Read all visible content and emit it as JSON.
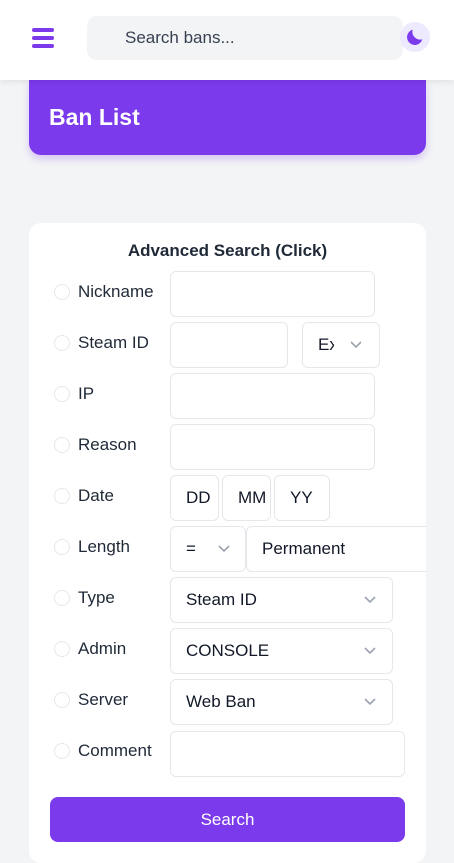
{
  "topbar": {
    "search_placeholder": "Search bans...",
    "menu_icon": "hamburger-icon",
    "theme_icon": "moon-icon"
  },
  "header": {
    "title": "Ban List"
  },
  "colors": {
    "accent": "#7c3aed",
    "background": "#f3f4f6"
  },
  "advanced_search": {
    "title": "Advanced Search (Click)",
    "fields": {
      "nickname": {
        "label": "Nickname",
        "value": ""
      },
      "steam_id": {
        "label": "Steam ID",
        "value": "",
        "match_select": "Ex"
      },
      "ip": {
        "label": "IP",
        "value": ""
      },
      "reason": {
        "label": "Reason",
        "value": ""
      },
      "date": {
        "label": "Date",
        "day": "DD",
        "month": "MM",
        "year": "YY"
      },
      "length": {
        "label": "Length",
        "operator": "=",
        "value": "Permanent"
      },
      "type": {
        "label": "Type",
        "value": "Steam ID"
      },
      "admin": {
        "label": "Admin",
        "value": "CONSOLE"
      },
      "server": {
        "label": "Server",
        "value": "Web Ban"
      },
      "comment": {
        "label": "Comment",
        "value": ""
      }
    },
    "search_button": "Search"
  }
}
